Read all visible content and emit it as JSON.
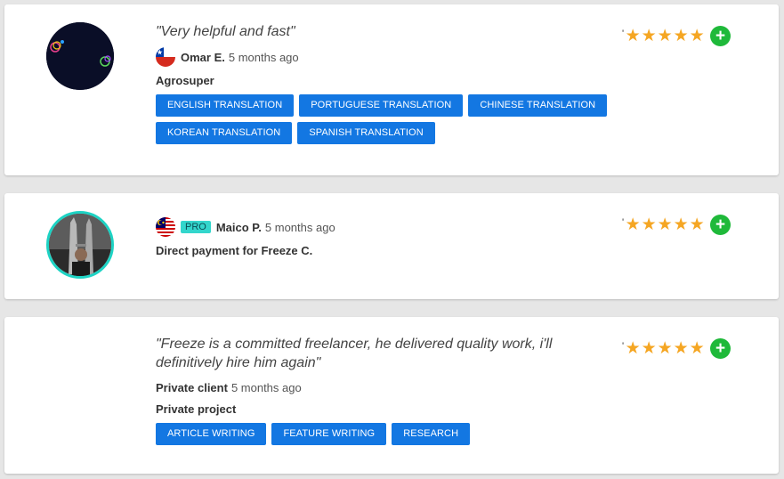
{
  "reviews": [
    {
      "quote": "\"Very helpful and fast\"",
      "reviewer": "Omar E.",
      "time": "5 months ago",
      "project": "Agrosuper",
      "tags": [
        "ENGLISH TRANSLATION",
        "PORTUGUESE TRANSLATION",
        "CHINESE TRANSLATION",
        "KOREAN TRANSLATION",
        "SPANISH TRANSLATION"
      ],
      "rating": 5,
      "flag": "chile"
    },
    {
      "badge": "PRO",
      "reviewer": "Maico P.",
      "time": "5 months ago",
      "project": "Direct payment for Freeze C.",
      "rating": 5,
      "flag": "malaysia"
    },
    {
      "quote": "\"Freeze is a committed freelancer, he delivered quality work, i'll definitively hire him again\"",
      "reviewer": "Private client",
      "time": "5 months ago",
      "project": "Private project",
      "tags": [
        "ARTICLE WRITING",
        "FEATURE WRITING",
        "RESEARCH"
      ],
      "rating": 5
    }
  ],
  "colors": {
    "tag_blue": "#1377e2",
    "star_gold": "#f5a623",
    "add_green": "#1fb93a",
    "pro_teal": "#33d6cc"
  },
  "icons": {
    "star": "star-icon",
    "add": "plus-circle-icon"
  }
}
